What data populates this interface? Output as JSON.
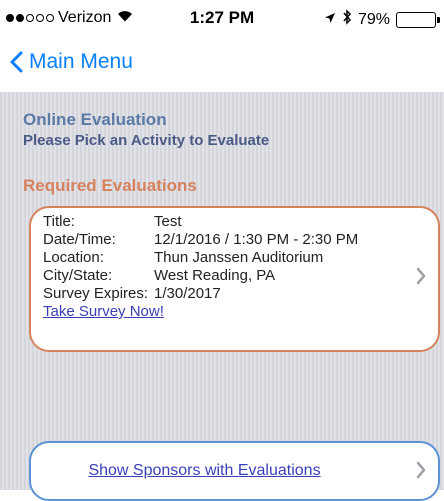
{
  "status_bar": {
    "carrier": "Verizon",
    "signal_bars": 2,
    "time": "1:27 PM",
    "battery": "79%",
    "battery_level": 0.79
  },
  "nav": {
    "back_label": "Main Menu"
  },
  "page": {
    "title": "Online Evaluation",
    "subtitle": "Please Pick an Activity to Evaluate",
    "section_title": "Required Evaluations"
  },
  "evaluation": {
    "title_label": "Title:",
    "title_value": "Test",
    "datetime_label": "Date/Time:",
    "datetime_value": "12/1/2016 / 1:30 PM - 2:30 PM",
    "location_label": "Location:",
    "location_value": "Thun Janssen Auditorium",
    "citystate_label": "City/State:",
    "citystate_value": "West Reading, PA",
    "expires_label": "Survey Expires:",
    "expires_value": "1/30/2017",
    "action_label": "Take Survey Now!"
  },
  "sponsors": {
    "label": "Show Sponsors with Evaluations"
  },
  "colors": {
    "nav_blue": "#0a7ffb",
    "heading_blue": "#5b7aa6",
    "section_orange": "#d6825c",
    "link_purple": "#3a3fb8",
    "sponsor_border": "#5b93d4"
  },
  "icons": {
    "back": "chevron-left-icon",
    "disclosure": "chevron-right-icon",
    "wifi": "wifi-icon",
    "location": "location-arrow-icon",
    "bluetooth": "bluetooth-icon",
    "battery": "battery-icon"
  }
}
